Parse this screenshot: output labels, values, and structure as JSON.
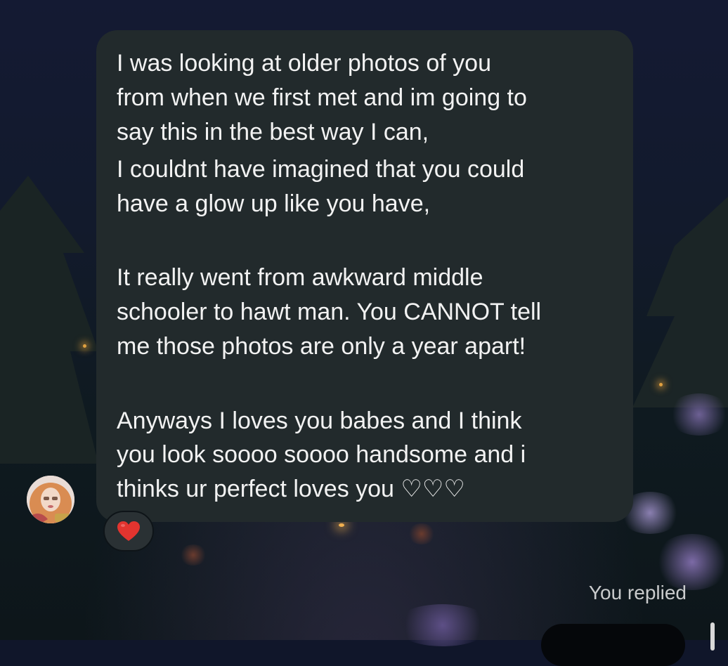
{
  "message": {
    "lines": [
      "I was looking at older photos of you",
      "from when we first met and im going to",
      "say this in the best way I can,",
      " I couldnt have imagined that you could",
      "have a glow up like you have,",
      "It really went from awkward middle",
      "schooler to hawt man. You CANNOT tell",
      "me those photos are only a year apart!",
      "Anyways I loves you babes and I think",
      "you look soooo soooo handsome and i",
      "thinks ur perfect loves you ♡♡♡"
    ]
  },
  "sender_avatar": {
    "icon": "profile-photo"
  },
  "reaction": {
    "emoji": "❤️",
    "icon": "heart-icon"
  },
  "status": {
    "replied_label": "You replied"
  },
  "colors": {
    "bubble": "#222a2c",
    "text": "#f2f2f2",
    "heart": "#e3342f"
  }
}
